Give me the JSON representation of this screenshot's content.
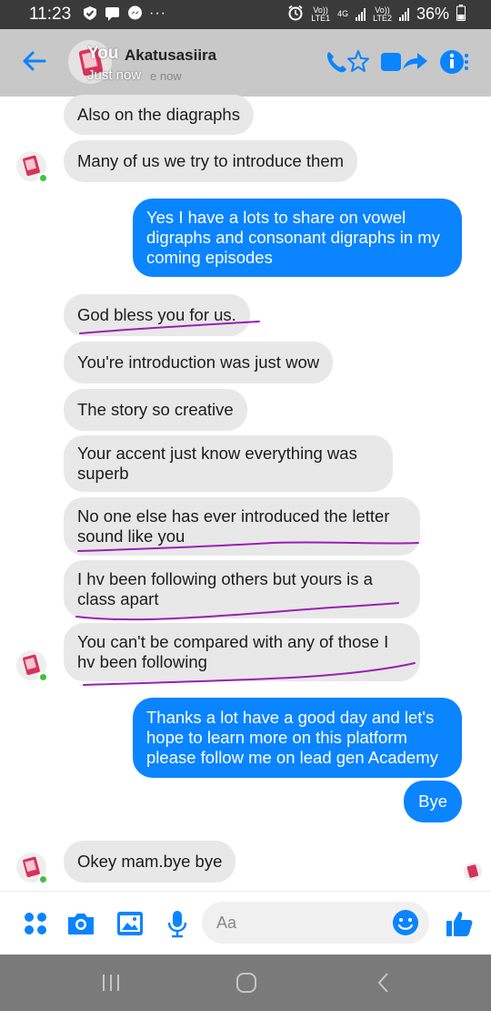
{
  "status_bar": {
    "time": "11:23",
    "net1_top": "Vo))",
    "net1_bottom": "LTE1",
    "net_type": "4G",
    "net2_top": "Vo))",
    "net2_bottom": "LTE2",
    "battery": "36%",
    "more": "···"
  },
  "header": {
    "title_overlay": "You",
    "contact_name": "Akatusasiira",
    "status_overlay": "Just now",
    "status_text": "e now"
  },
  "messages": [
    {
      "text": "Also on the diagraphs"
    },
    {
      "text": "Many of us we try to introduce  them"
    },
    {
      "text": "Yes I have a lots to share on vowel digraphs and consonant digraphs in my coming episodes"
    },
    {
      "text": "God bless  you for us."
    },
    {
      "text": "You're  introduction  was just wow"
    },
    {
      "text": "The story so creative"
    },
    {
      "text": "Your accent  just know  everything  was superb"
    },
    {
      "text": "No one else has ever  introduced  the letter sound like you"
    },
    {
      "text": "I hv been following  others  but yours is a class apart"
    },
    {
      "text": "You can't be compared  with any of those I hv been following"
    },
    {
      "text": "Thanks a lot have a good day and let's hope to learn more on this platform please follow me on lead gen Academy"
    },
    {
      "text": "Bye"
    },
    {
      "text": "Okey mam.bye bye"
    }
  ],
  "composer": {
    "placeholder": "Aa"
  },
  "colors": {
    "accent": "#0a84ff",
    "incoming_bubble": "#e8e8e8",
    "header_bg": "#c8c8c8",
    "annotation": "#9b1fb5",
    "online": "#41c23e"
  }
}
